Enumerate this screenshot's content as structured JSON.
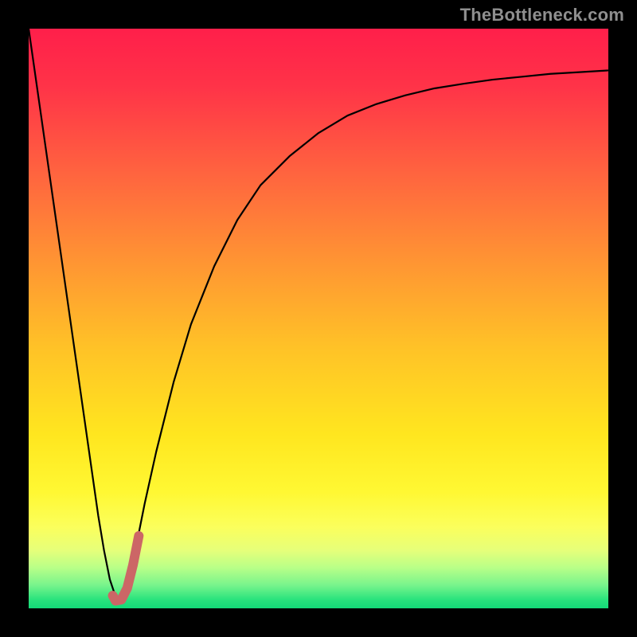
{
  "credit": "TheBottleneck.com",
  "colors": {
    "gradient_stops": [
      {
        "offset": 0.0,
        "color": "#ff1f4a"
      },
      {
        "offset": 0.1,
        "color": "#ff3348"
      },
      {
        "offset": 0.25,
        "color": "#ff643f"
      },
      {
        "offset": 0.4,
        "color": "#ff9433"
      },
      {
        "offset": 0.55,
        "color": "#ffc227"
      },
      {
        "offset": 0.7,
        "color": "#ffe61f"
      },
      {
        "offset": 0.8,
        "color": "#fff833"
      },
      {
        "offset": 0.86,
        "color": "#fbff5c"
      },
      {
        "offset": 0.9,
        "color": "#e6ff7a"
      },
      {
        "offset": 0.93,
        "color": "#b8ff88"
      },
      {
        "offset": 0.96,
        "color": "#78f48c"
      },
      {
        "offset": 0.985,
        "color": "#29e37d"
      },
      {
        "offset": 1.0,
        "color": "#13da78"
      }
    ],
    "curve": "#000000",
    "mark": "#cc6666"
  },
  "chart_data": {
    "type": "line",
    "title": "",
    "xlabel": "",
    "ylabel": "",
    "xlim": [
      0,
      100
    ],
    "ylim": [
      0,
      100
    ],
    "legend": false,
    "grid": false,
    "series": [
      {
        "name": "bottleneck-curve",
        "x": [
          0,
          3,
          6,
          9,
          12,
          13,
          14,
          15,
          16,
          17,
          18,
          20,
          22,
          25,
          28,
          32,
          36,
          40,
          45,
          50,
          55,
          60,
          65,
          70,
          75,
          80,
          85,
          90,
          95,
          100
        ],
        "y": [
          100,
          79,
          58,
          37,
          16,
          10,
          5,
          2,
          1,
          3,
          8,
          18,
          27,
          39,
          49,
          59,
          67,
          73,
          78,
          82,
          85,
          87,
          88.5,
          89.7,
          90.5,
          91.2,
          91.7,
          92.2,
          92.5,
          92.8
        ]
      },
      {
        "name": "highlight-mark",
        "x": [
          14.5,
          15,
          16,
          17,
          18,
          19
        ],
        "y": [
          2.2,
          1.3,
          1.5,
          3.5,
          7.5,
          12.5
        ]
      }
    ],
    "annotations": []
  }
}
